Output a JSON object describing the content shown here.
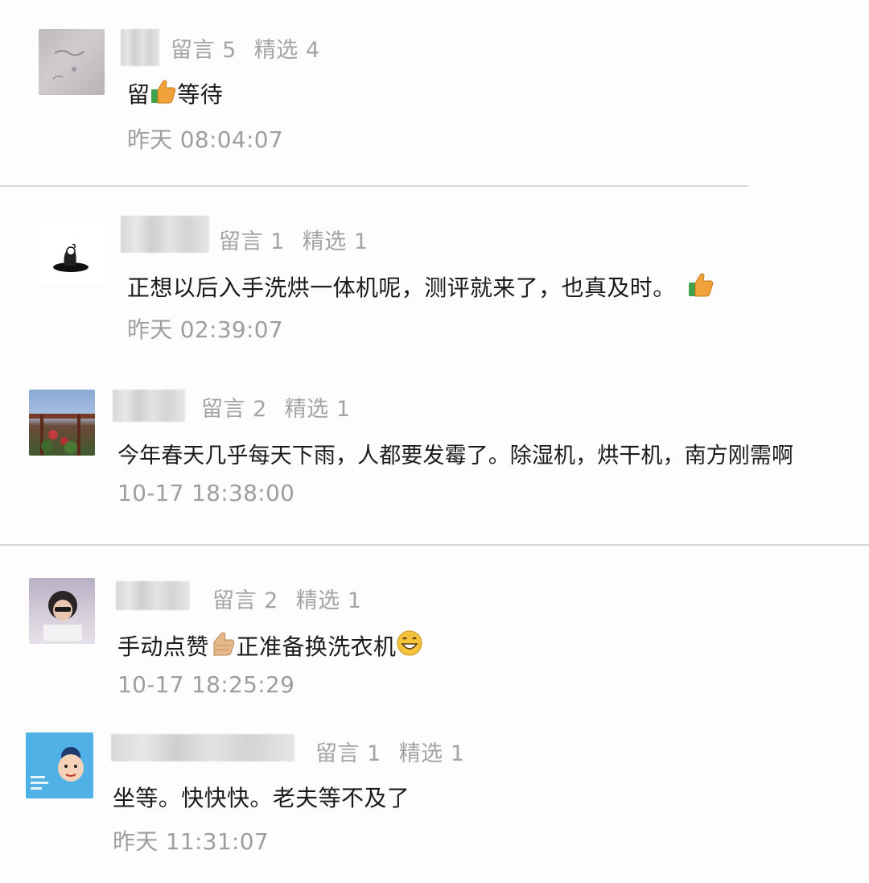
{
  "comments": [
    {
      "stats": {
        "messages": "留言 5",
        "featured": "精选 4"
      },
      "text": {
        "before": "留",
        "after": "等待"
      },
      "emoji": "thumbs-up-icon",
      "time": "昨天 08:04:07"
    },
    {
      "stats": {
        "messages": "留言 1",
        "featured": "精选 1"
      },
      "text": {
        "before": "正想以后入手洗烘一体机呢，测评就来了，也真及时。",
        "after": ""
      },
      "emoji": "thumbs-up-icon",
      "time": "昨天 02:39:07"
    },
    {
      "stats": {
        "messages": "留言 2",
        "featured": "精选 1"
      },
      "text": {
        "before": "今年春天几乎每天下雨，人都要发霉了。除湿机，烘干机，南方刚需啊",
        "after": ""
      },
      "time": "10-17 18:38:00"
    },
    {
      "stats": {
        "messages": "留言 2",
        "featured": "精选 1"
      },
      "text": {
        "before": "手动点赞",
        "middle": "正准备换洗衣机",
        "after": ""
      },
      "emoji": "thumbs-up-icon",
      "emoji2": "grinning-face-icon",
      "time": "10-17 18:25:29"
    },
    {
      "stats": {
        "messages": "留言 1",
        "featured": "精选 1"
      },
      "text": {
        "before": "坐等。快快快。老夫等不及了",
        "after": ""
      },
      "time": "昨天 11:31:07"
    }
  ],
  "colors": {
    "text": "#1b1b1b",
    "meta": "#a4a4a4",
    "divider": "#d6d6d6",
    "thumb": "#f2a23a",
    "cuff": "#3ea34a",
    "grin": "#f5c33b"
  }
}
